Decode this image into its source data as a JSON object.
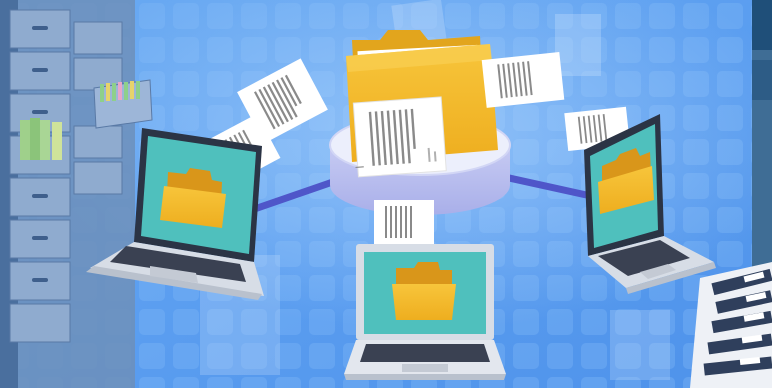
{
  "scene": {
    "description_free": true,
    "colors": {
      "background": "#5b9ef0",
      "background_light": "#86bdf7",
      "tile": "#74b0f4",
      "connector": "#4f56c9",
      "hub_top": "#e9ecfb",
      "hub_side": "#b8bdf0",
      "folder": "#f2b728",
      "folder_dark": "#d9961a",
      "screen": "#4fc0bd",
      "laptop_body": "#d7dde6",
      "laptop_frame": "#2b3445",
      "keyboard": "#3a4152",
      "document": "#ffffff",
      "doc_lines": "#8a8a8a",
      "cabinet": "#6f8fb7",
      "binder_dark": "#2f3f5c"
    },
    "icons": [
      "filing-cabinet-icon",
      "hub-folder-icon",
      "laptop-icon",
      "folder-icon",
      "document-icon",
      "binders-icon"
    ]
  }
}
